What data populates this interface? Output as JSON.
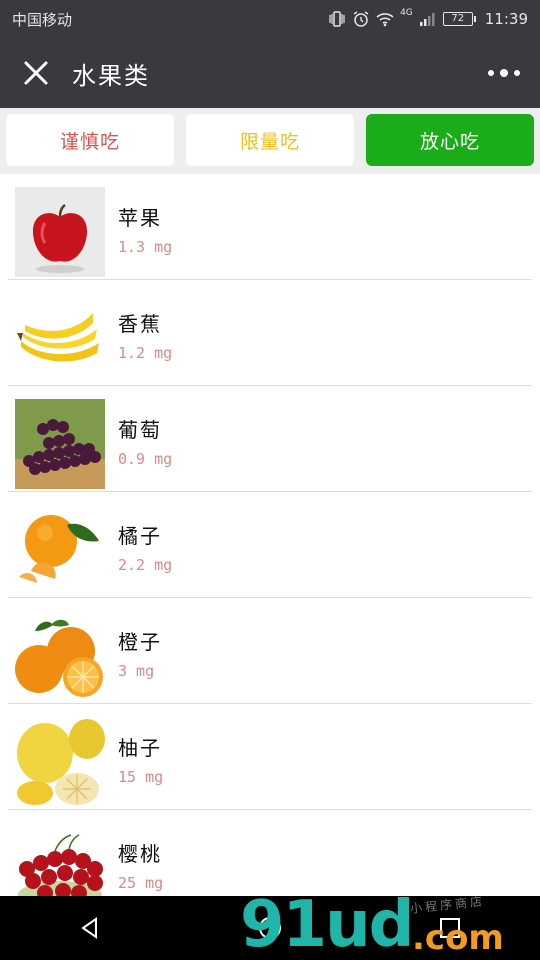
{
  "status_bar": {
    "carrier": "中国移动",
    "network": "4G",
    "battery": "72",
    "time": "11:39"
  },
  "header": {
    "close_icon": "close-icon",
    "title": "水果类",
    "more_icon": "more-icon"
  },
  "tabs": [
    {
      "label": "谨慎吃",
      "color": "#d9534f",
      "active": false
    },
    {
      "label": "限量吃",
      "color": "#f0c020",
      "active": false
    },
    {
      "label": "放心吃",
      "color": "#ffffff",
      "active": true,
      "background": "#1aad19"
    }
  ],
  "items": [
    {
      "name": "苹果",
      "value": "1.3 mg",
      "icon": "apple-image"
    },
    {
      "name": "香蕉",
      "value": "1.2 mg",
      "icon": "banana-image"
    },
    {
      "name": "葡萄",
      "value": "0.9 mg",
      "icon": "grape-image"
    },
    {
      "name": "橘子",
      "value": "2.2 mg",
      "icon": "tangerine-image"
    },
    {
      "name": "橙子",
      "value": "3 mg",
      "icon": "orange-image"
    },
    {
      "name": "柚子",
      "value": "15 mg",
      "icon": "pomelo-image"
    },
    {
      "name": "樱桃",
      "value": "25 mg",
      "icon": "cherry-image"
    }
  ],
  "nav": {
    "back_icon": "back-triangle-icon",
    "home_icon": "home-circle-icon",
    "recent_icon": "recent-square-icon"
  },
  "watermark": {
    "main": "91ud",
    "suffix": ".com",
    "small": "小程序商店"
  }
}
